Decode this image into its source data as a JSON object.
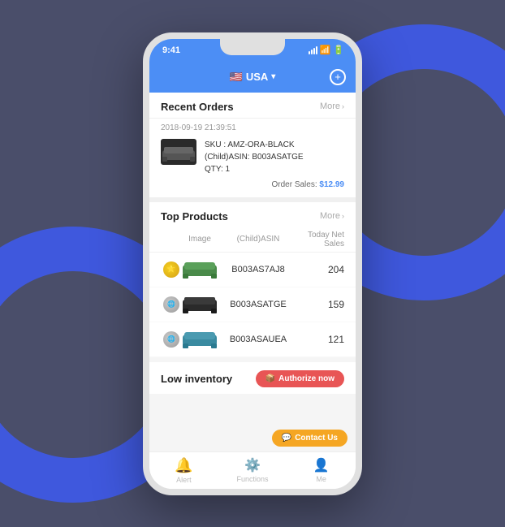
{
  "background": {
    "color": "#4a4e6a"
  },
  "phone": {
    "status_bar": {
      "time": "9:41"
    },
    "header": {
      "country": "USA",
      "flag": "🇺🇸",
      "dropdown_arrow": "▾"
    },
    "recent_orders": {
      "title": "Recent Orders",
      "more_label": "More",
      "order": {
        "date": "2018-09-19 21:39:51",
        "sku": "SKU : AMZ-ORA-BLACK",
        "child_asin": "(Child)ASIN: B003ASATGE",
        "qty": "QTY: 1",
        "sales_label": "Order Sales:",
        "sales_amount": "$12.99"
      }
    },
    "top_products": {
      "title": "Top Products",
      "more_label": "More",
      "columns": {
        "image": "Image",
        "asin": "(Child)ASIN",
        "sales": "Today Net Sales"
      },
      "rows": [
        {
          "asin": "B003AS7AJ8",
          "sales": "204"
        },
        {
          "asin": "B003ASATGE",
          "sales": "159"
        },
        {
          "asin": "B003ASAUEA",
          "sales": "121"
        }
      ]
    },
    "low_inventory": {
      "title": "Low inventory",
      "authorize_label": "Authorize now",
      "contact_label": "Contact Us"
    },
    "bottom_nav": {
      "items": [
        {
          "icon": "🔔",
          "label": "Alert"
        },
        {
          "icon": "⚙",
          "label": "Functions"
        },
        {
          "icon": "👤",
          "label": "Me"
        }
      ]
    }
  }
}
